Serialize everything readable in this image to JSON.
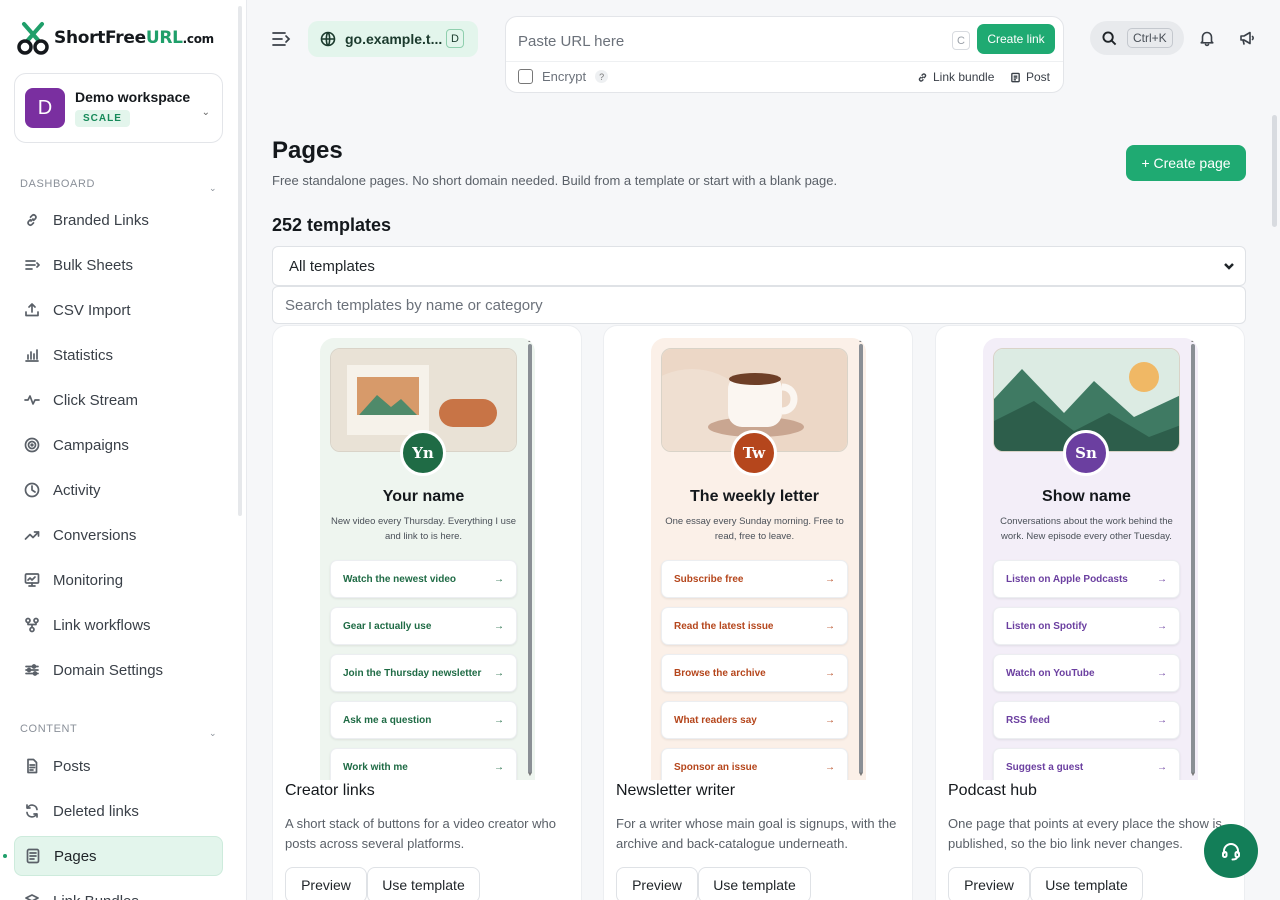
{
  "brand": {
    "name_main": "ShortFree",
    "name_accent": "URL",
    "name_suffix": ".com",
    "accent_color": "#1f9f6a"
  },
  "workspace": {
    "initial": "D",
    "name": "Demo workspace",
    "plan": "SCALE"
  },
  "sidebar": {
    "dashboard_title": "DASHBOARD",
    "dashboard_items": [
      {
        "label": "Branded Links",
        "icon": "link-icon"
      },
      {
        "label": "Bulk Sheets",
        "icon": "list-icon"
      },
      {
        "label": "CSV Import",
        "icon": "upload-icon"
      },
      {
        "label": "Statistics",
        "icon": "bar-chart-icon"
      },
      {
        "label": "Click Stream",
        "icon": "pulse-icon"
      },
      {
        "label": "Campaigns",
        "icon": "target-icon"
      },
      {
        "label": "Activity",
        "icon": "clock-icon"
      },
      {
        "label": "Conversions",
        "icon": "trend-up-icon"
      },
      {
        "label": "Monitoring",
        "icon": "monitor-icon"
      },
      {
        "label": "Link workflows",
        "icon": "workflow-icon"
      },
      {
        "label": "Domain Settings",
        "icon": "sliders-icon"
      }
    ],
    "content_title": "CONTENT",
    "content_items": [
      {
        "label": "Posts",
        "icon": "document-icon"
      },
      {
        "label": "Deleted links",
        "icon": "refresh-icon"
      },
      {
        "label": "Pages",
        "icon": "page-icon",
        "active": true
      },
      {
        "label": "Link Bundles",
        "icon": "layers-icon"
      }
    ]
  },
  "topbar": {
    "domain": "go.example.t...",
    "domain_shortcut": "D",
    "url_placeholder": "Paste URL here",
    "url_shortcut": "C",
    "create_link": "Create link",
    "encrypt_label": "Encrypt",
    "encrypt_help": "?",
    "link_bundle": "Link bundle",
    "post": "Post",
    "search_shortcut": "Ctrl+K"
  },
  "main": {
    "title": "Pages",
    "subtitle": "Free standalone pages. No short domain needed. Build from a template or start with a blank page.",
    "create_page": "+ Create page",
    "template_count": "252 templates",
    "filter_selected": "All templates",
    "search_placeholder": "Search templates by name or category"
  },
  "templates": [
    {
      "preview_initials": "Yn",
      "preview_title": "Your name",
      "preview_desc": "New video every Thursday. Everything I use and link to is here.",
      "preview_links": [
        "Watch the newest video",
        "Gear I actually use",
        "Join the Thursday newsletter",
        "Ask me a question",
        "Work with me"
      ],
      "name": "Creator links",
      "description": "A short stack of buttons for a video creator who posts across several platforms.",
      "accent": "#1f6b45",
      "bg": "#eef5ef"
    },
    {
      "preview_initials": "Tw",
      "preview_title": "The weekly letter",
      "preview_desc": "One essay every Sunday morning. Free to read, free to leave.",
      "preview_links": [
        "Subscribe free",
        "Read the latest issue",
        "Browse the archive",
        "What readers say",
        "Sponsor an issue"
      ],
      "name": "Newsletter writer",
      "description": "For a writer whose main goal is signups, with the archive and back-catalogue underneath.",
      "accent": "#b5461c",
      "bg": "#fbf0e8"
    },
    {
      "preview_initials": "Sn",
      "preview_title": "Show name",
      "preview_desc": "Conversations about the work behind the work. New episode every other Tuesday.",
      "preview_links": [
        "Listen on Apple Podcasts",
        "Listen on Spotify",
        "Watch on YouTube",
        "RSS feed",
        "Suggest a guest"
      ],
      "name": "Podcast hub",
      "description": "One page that points at every place the show is published, so the bio link never changes.",
      "accent": "#6b3fa0",
      "bg": "#f3eef8"
    }
  ],
  "card_buttons": {
    "preview": "Preview",
    "use": "Use template"
  },
  "link_arrow": "→"
}
